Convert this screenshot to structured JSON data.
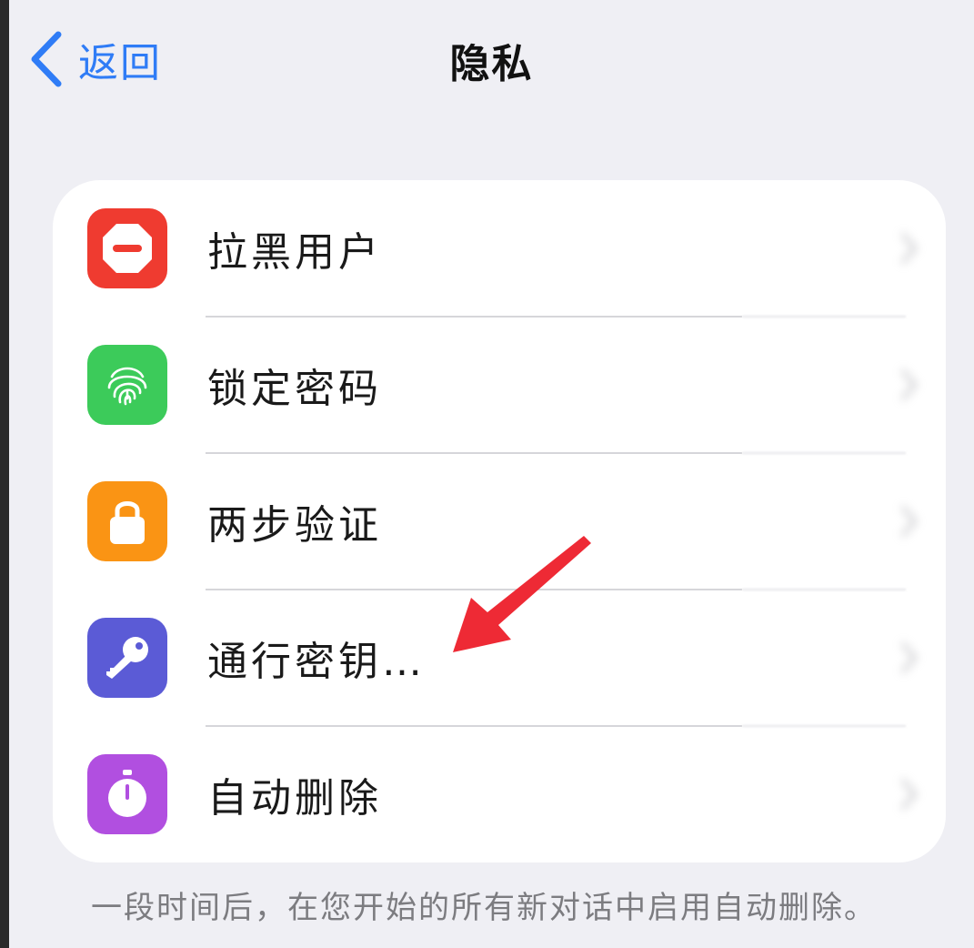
{
  "nav": {
    "back_label": "返回",
    "title": "隐私"
  },
  "rows": [
    {
      "label": "拉黑用户",
      "value": "",
      "icon": "stop-icon",
      "color": "#ef3b30"
    },
    {
      "label": "锁定密码",
      "value": "",
      "icon": "fingerprint-icon",
      "color": "#3ccb5a"
    },
    {
      "label": "两步验证",
      "value": "",
      "icon": "lock-icon",
      "color": "#fa9414"
    },
    {
      "label": "通行密钥…",
      "value": "",
      "icon": "key-icon",
      "color": "#5b5bd6"
    },
    {
      "label": "自动删除",
      "value": "",
      "icon": "timer-icon",
      "color": "#b14fe0"
    }
  ],
  "footer": {
    "note": "一段时间后，在您开始的所有新对话中启用自动删除。"
  },
  "annotation": {
    "color": "#ee2a35"
  },
  "colors": {
    "accent": "#2f7cf6",
    "background": "#efeff4"
  }
}
